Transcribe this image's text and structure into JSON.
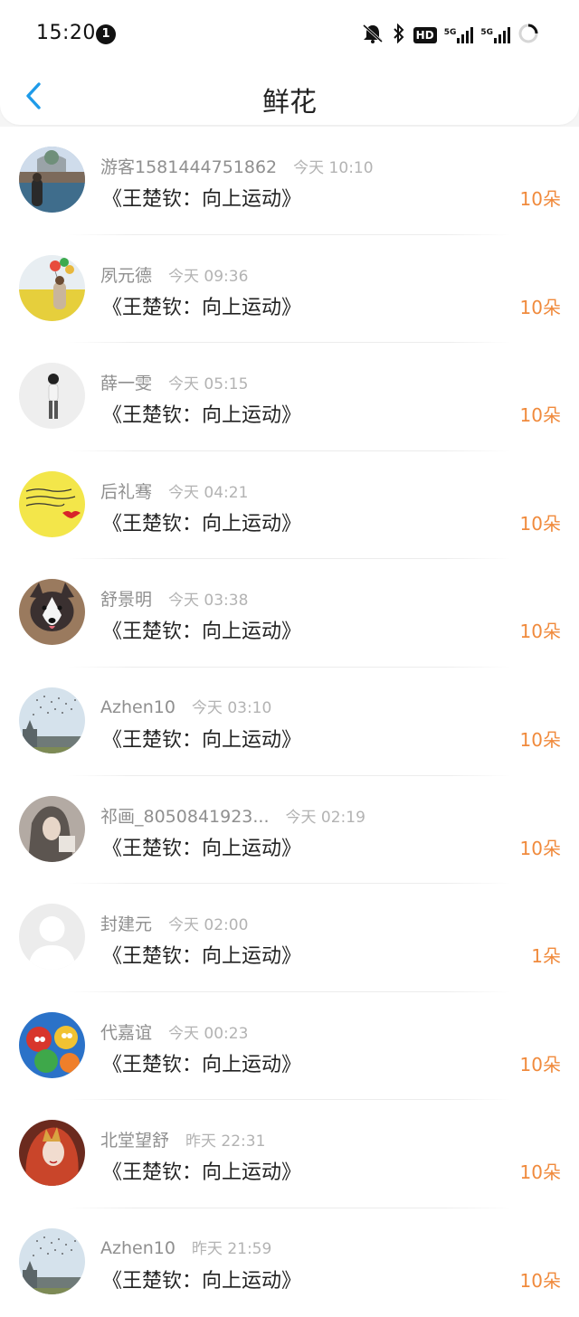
{
  "status_bar": {
    "time": "15:20",
    "notification_count": "1",
    "hd_label": "HD",
    "network_1": "5G",
    "network_2": "5G"
  },
  "nav": {
    "title": "鲜花"
  },
  "colors": {
    "accent_blue": "#1e9be9",
    "count_orange": "#f08a3c"
  },
  "items": [
    {
      "user": "游客1581444751862",
      "time": "今天 10:10",
      "book": "《王楚钦：向上运动》",
      "count": "10朵",
      "avatar": "venice-photo"
    },
    {
      "user": "夙元德",
      "time": "今天 09:36",
      "book": "《王楚钦：向上运动》",
      "count": "10朵",
      "avatar": "girl-balloons-field"
    },
    {
      "user": "薛一雯",
      "time": "今天 05:15",
      "book": "《王楚钦：向上运动》",
      "count": "10朵",
      "avatar": "standing-figure"
    },
    {
      "user": "后礼骞",
      "time": "今天 04:21",
      "book": "《王楚钦：向上运动》",
      "count": "10朵",
      "avatar": "yellow-note-lips"
    },
    {
      "user": "舒景明",
      "time": "今天 03:38",
      "book": "《王楚钦：向上运动》",
      "count": "10朵",
      "avatar": "husky-dog"
    },
    {
      "user": "Azhen10",
      "time": "今天 03:10",
      "book": "《王楚钦：向上运动》",
      "count": "10朵",
      "avatar": "birds-sky-building"
    },
    {
      "user": "祁画_8050841923...",
      "time": "今天 02:19",
      "book": "《王楚钦：向上运动》",
      "count": "10朵",
      "avatar": "hooded-figure"
    },
    {
      "user": "封建元",
      "time": "今天 02:00",
      "book": "《王楚钦：向上运动》",
      "count": "1朵",
      "avatar": "default-avatar"
    },
    {
      "user": "代嘉谊",
      "time": "今天 00:23",
      "book": "《王楚钦：向上运动》",
      "count": "10朵",
      "avatar": "cartoon-characters"
    },
    {
      "user": "北堂望舒",
      "time": "昨天 22:31",
      "book": "《王楚钦：向上运动》",
      "count": "10朵",
      "avatar": "red-hair-woman"
    },
    {
      "user": "Azhen10",
      "time": "昨天 21:59",
      "book": "《王楚钦：向上运动》",
      "count": "10朵",
      "avatar": "birds-sky-building"
    }
  ]
}
